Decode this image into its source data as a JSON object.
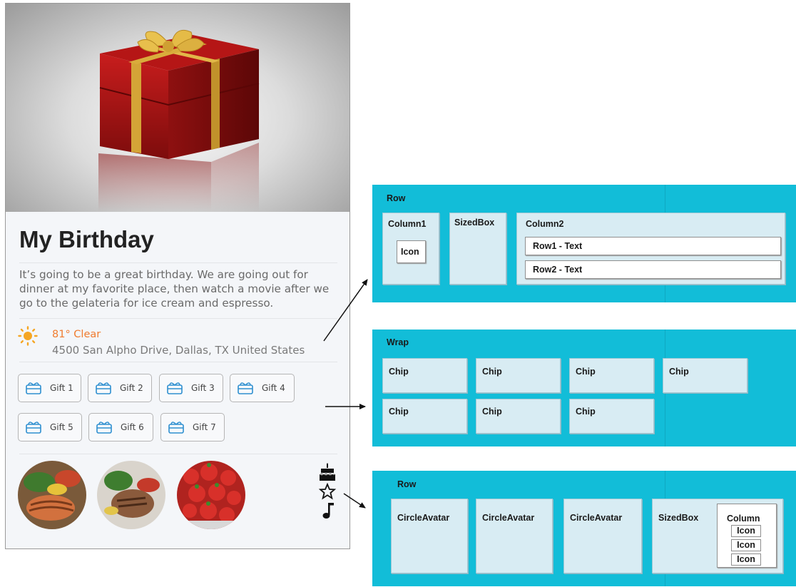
{
  "card": {
    "title": "My Birthday",
    "description": "It’s going to be a great birthday. We are going out for dinner at my favorite place, then watch a movie after we go to the gelateria for ice cream and espresso.",
    "weather": "81° Clear",
    "address": "4500 San Alpho Drive, Dallas, TX United States",
    "gifts": [
      "Gift 1",
      "Gift 2",
      "Gift 3",
      "Gift 4",
      "Gift 5",
      "Gift 6",
      "Gift 7"
    ],
    "side_icons": [
      "cake-icon",
      "star-icon",
      "music-note-icon"
    ],
    "colors": {
      "weather": "#f07c2f",
      "diagram_bg": "#12bdd8",
      "diagram_box": "#d8ecf3"
    }
  },
  "diagram_row1": {
    "root": "Row",
    "column1": "Column1",
    "icon": "Icon",
    "sizedbox": "SizedBox",
    "column2": "Column2",
    "row1_text": "Row1 - Text",
    "row2_text": "Row2 - Text"
  },
  "diagram_wrap": {
    "root": "Wrap",
    "chips": [
      "Chip",
      "Chip",
      "Chip",
      "Chip",
      "Chip",
      "Chip",
      "Chip"
    ]
  },
  "diagram_row2": {
    "root": "Row",
    "avatars": [
      "CircleAvatar",
      "CircleAvatar",
      "CircleAvatar"
    ],
    "sizedbox": "SizedBox",
    "column": "Column",
    "icons": [
      "Icon",
      "Icon",
      "Icon"
    ]
  }
}
